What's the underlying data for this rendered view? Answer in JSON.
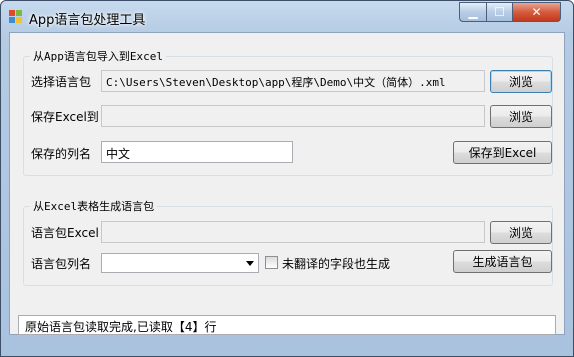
{
  "window": {
    "title": "App语言包处理工具",
    "minimize_glyph": "▁",
    "maximize_glyph": "☐",
    "close_glyph": "✕"
  },
  "import_group": {
    "legend": "从App语言包导入到Excel",
    "select_label": "选择语言包",
    "select_path": "C:\\Users\\Steven\\Desktop\\app\\程序\\Demo\\中文（简体）.xml",
    "browse1_label": "浏览",
    "save_excel_label": "保存Excel到",
    "save_excel_path": "",
    "browse2_label": "浏览",
    "column_label": "保存的列名",
    "column_value": "中文",
    "save_button_label": "保存到Excel"
  },
  "export_group": {
    "legend": "从Excel表格生成语言包",
    "excel_label": "语言包Excel",
    "excel_path": "",
    "browse3_label": "浏览",
    "column_label": "语言包列名",
    "column_selected": "",
    "untranslated_label": "未翻译的字段也生成",
    "untranslated_checked": false,
    "generate_label": "生成语言包"
  },
  "status": {
    "text": "原始语言包读取完成,已读取【4】行"
  }
}
